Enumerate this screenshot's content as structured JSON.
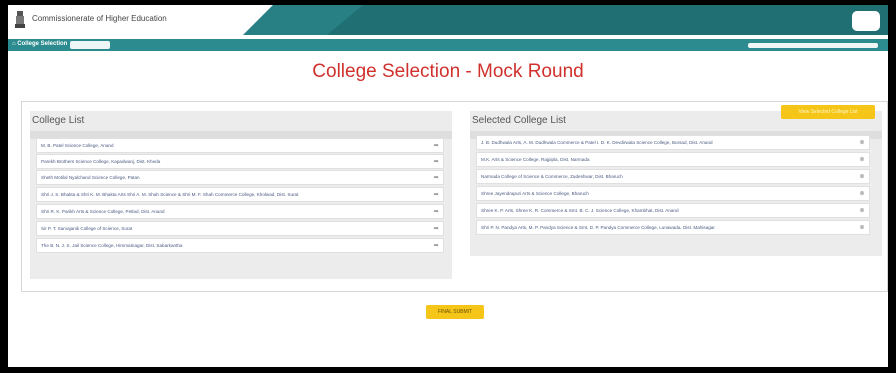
{
  "header": {
    "brand": "Commissionerate of Higher Education"
  },
  "subbar": {
    "label": "College Selection"
  },
  "page_title": "College Selection - Mock Round",
  "college_list": {
    "title": "College List",
    "items": [
      "M. B. Patel Science College, Anand",
      "Parekh Brothers Science College, Kapadwanj, Dist. Kheda",
      "Sheth Motilal Nyalchand Science College, Patan",
      "Shri J. S. Bhakta & Shri K. M. Bhakta Arts Shri A. M. Shah Science & Shri M. F. Shah Commerce College, Kholwad, Dist. Surat",
      "Shri R. K. Parikh Arts & Science College, Petlad, Dist. Anand",
      "Sir P. T. Sarvajanik College of Science, Surat",
      "The B. N. J. S. Jail Science College, Himmatnagar, Dist. Sabarkantha"
    ]
  },
  "selected_list": {
    "title": "Selected College List",
    "view_button": "View Selected College List",
    "items": [
      "J. B. Dudhwala Arts, A. M. Dudhwala Commerce & Patel I. D. K. Devdirwala Science College, Bursad, Dist. Anand",
      "M.K. Arts & Science College, Rajpipla, Dist. Narmada",
      "Narmada College of Science & Commerce, Zadeshwar, Dist. Bharuch",
      "Shree Jayendrapuri Arts & Science College, Bharuch",
      "Shree K. P. Arts, Shree K. R. Commerce & Smt. B. C. J. Science College, Khambhat, Dist. Anand",
      "Shri P. N. Pandya Arts, M. P. Pandya Science & Smt. D. P. Pandya Commerce College, Lunawada, Dist. Mahisagar"
    ]
  },
  "submit_button": "FINAL SUBMIT",
  "icons": {
    "add": "arrow-right-icon",
    "remove": "remove-icon"
  },
  "colors": {
    "header_teal": "#1f6f73",
    "subbar_teal": "#2c8b8e",
    "title_red": "#d0312d",
    "button_yellow": "#f5c518"
  }
}
